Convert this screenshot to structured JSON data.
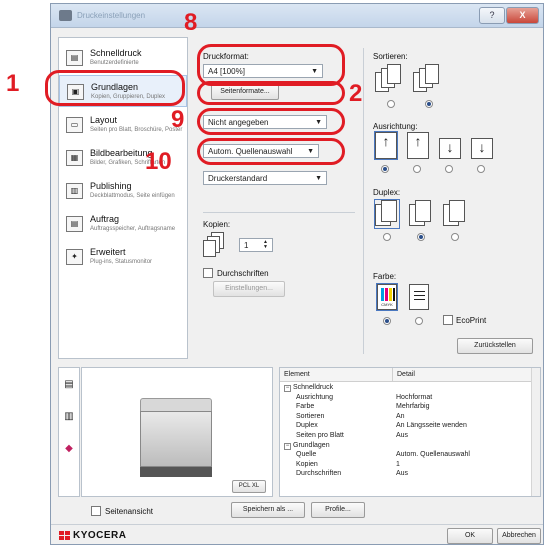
{
  "window": {
    "title": "Druckeinstellungen",
    "help": "?",
    "close": "X"
  },
  "callouts": [
    "1",
    "2",
    "8",
    "9",
    "10"
  ],
  "nav": [
    {
      "title": "Schnelldruck",
      "sub": "Benutzerdefinierte",
      "icon": "quick-print-icon"
    },
    {
      "title": "Grundlagen",
      "sub": "Kopien, Gruppieren, Duplex",
      "icon": "basics-icon"
    },
    {
      "title": "Layout",
      "sub": "Seiten pro Blatt, Broschüre, Poster",
      "icon": "layout-icon"
    },
    {
      "title": "Bildbearbeitung",
      "sub": "Bilder, Grafiken, Schriftarten",
      "icon": "image-icon"
    },
    {
      "title": "Publishing",
      "sub": "Deckblattmodus, Seite einfügen",
      "icon": "publishing-icon"
    },
    {
      "title": "Auftrag",
      "sub": "Auftragsspeicher, Auftragsname",
      "icon": "job-icon"
    },
    {
      "title": "Erweitert",
      "sub": "Plug-ins, Statusmonitor",
      "icon": "advanced-icon"
    }
  ],
  "main": {
    "druckformat_label": "Druckformat:",
    "druckformat_value": "A4  [100%]",
    "seitenformate_button": "Seitenformate...",
    "papier_value": "Nicht angegeben",
    "quelle_value": "Autom. Quellenauswahl",
    "medientyp_value": "Druckerstandard",
    "kopien_label": "Kopien:",
    "kopien_value": "1",
    "durchschriften_label": "Durchschriften",
    "einstellungen_button": "Einstellungen..."
  },
  "right": {
    "sortieren_label": "Sortieren:",
    "ausrichtung_label": "Ausrichtung:",
    "duplex_label": "Duplex:",
    "farbe_label": "Farbe:",
    "ecoprint_label": "EcoPrint",
    "zuruecksetzen_button": "Zurückstellen",
    "color_badge": "CMYK"
  },
  "printer": {
    "badge": "PCL XL"
  },
  "table": {
    "header": [
      "Element",
      "Detail"
    ],
    "rows": [
      {
        "indent": 0,
        "group": true,
        "element": "Schnelldruck",
        "detail": ""
      },
      {
        "indent": 1,
        "element": "Ausrichtung",
        "detail": "Hochformat"
      },
      {
        "indent": 1,
        "element": "Farbe",
        "detail": "Mehrfarbig"
      },
      {
        "indent": 1,
        "element": "Sortieren",
        "detail": "An"
      },
      {
        "indent": 1,
        "element": "Duplex",
        "detail": "An Längsseite wenden"
      },
      {
        "indent": 1,
        "element": "Seiten pro Blatt",
        "detail": "Aus"
      },
      {
        "indent": 0,
        "group": true,
        "element": "Grundlagen",
        "detail": ""
      },
      {
        "indent": 1,
        "element": "Quelle",
        "detail": "Autom. Quellenauswahl"
      },
      {
        "indent": 1,
        "element": "Kopien",
        "detail": "1"
      },
      {
        "indent": 1,
        "element": "Durchschriften",
        "detail": "Aus"
      }
    ]
  },
  "footer": {
    "seitenansicht_label": "Seitenansicht",
    "speichern_button": "Speichern als ...",
    "profile_button": "Profile...",
    "brand": "KYOCERA",
    "ok_button": "OK",
    "abbrechen_button": "Abbrechen"
  },
  "colors": {
    "callout": "#e01c24",
    "brand": "#e01c24",
    "accent": "#2c4f8a"
  }
}
